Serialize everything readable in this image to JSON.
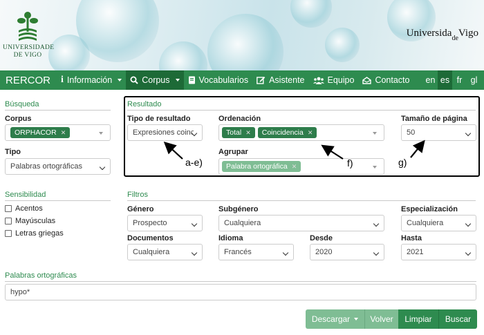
{
  "header": {
    "left_logo_text": "UNIVERSIDADE DE VIGO",
    "left_logo_line1": "UNIVERSIDADE",
    "left_logo_line2": "DE VIGO",
    "right_logo_text_1": "Universida",
    "right_logo_text_2": "de",
    "right_logo_text_3": "Vigo"
  },
  "nav": {
    "brand": "RERCOR",
    "items": [
      {
        "label": "Información",
        "icon": "info-icon"
      },
      {
        "label": "Corpus",
        "icon": "search-icon"
      },
      {
        "label": "Vocabularios",
        "icon": "book-icon"
      },
      {
        "label": "Asistente",
        "icon": "edit-icon"
      },
      {
        "label": "Equipo",
        "icon": "users-icon"
      },
      {
        "label": "Contacto",
        "icon": "mail-icon"
      }
    ],
    "langs": [
      "en",
      "es",
      "fr",
      "gl"
    ],
    "active_lang": "es"
  },
  "busqueda": {
    "title": "Búsqueda",
    "corpus_label": "Corpus",
    "corpus_tag": "ORPHACOR",
    "tipo_label": "Tipo",
    "tipo_value": "Palabras ortográficas"
  },
  "resultado": {
    "title": "Resultado",
    "tipo_label": "Tipo de resultado",
    "tipo_value": "Expresiones coinc",
    "ordenacion_label": "Ordenación",
    "ordenacion_tags": [
      "Total",
      "Coincidencia"
    ],
    "agrupar_label": "Agrupar",
    "agrupar_tag": "Palabra ortográfica",
    "tamano_label": "Tamaño de página",
    "tamano_value": "50"
  },
  "annotations": {
    "a": "a-e)",
    "f": "f)",
    "g": "g)"
  },
  "sensibilidad": {
    "title": "Sensibilidad",
    "options": [
      "Acentos",
      "Mayúsculas",
      "Letras griegas"
    ]
  },
  "filtros": {
    "title": "Filtros",
    "genero_label": "Género",
    "genero_value": "Prospecto",
    "subgenero_label": "Subgénero",
    "subgenero_value": "Cualquiera",
    "especializacion_label": "Especialización",
    "especializacion_value": "Cualquiera",
    "documentos_label": "Documentos",
    "documentos_value": "Cualquiera",
    "idioma_label": "Idioma",
    "idioma_value": "Francés",
    "desde_label": "Desde",
    "desde_value": "2020",
    "hasta_label": "Hasta",
    "hasta_value": "2021"
  },
  "palabras": {
    "title": "Palabras ortográficas",
    "value": "hypo*"
  },
  "buttons": {
    "descargar": "Descargar",
    "volver": "Volver",
    "limpiar": "Limpiar",
    "buscar": "Buscar"
  },
  "colors": {
    "primary": "#2e8b4f",
    "primary_dark": "#1d6a37",
    "tag": "#2e7d4b"
  }
}
